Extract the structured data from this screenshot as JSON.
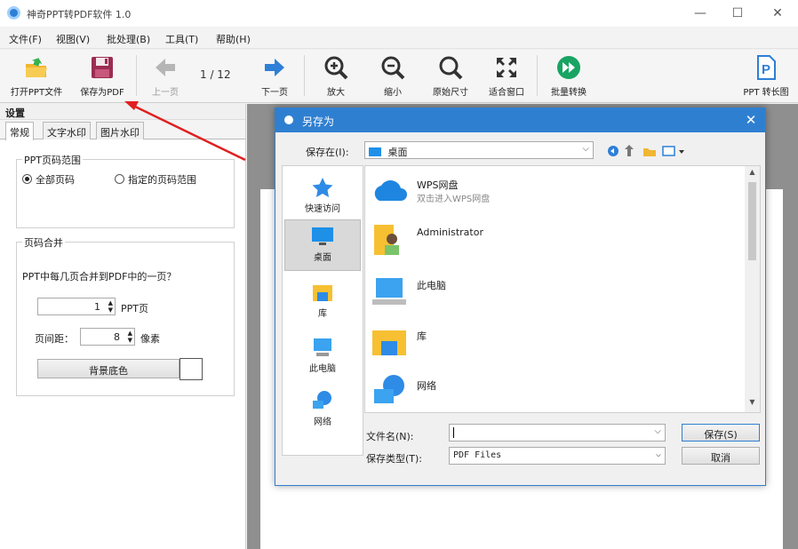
{
  "app": {
    "title": "神奇PPT转PDF软件 1.0",
    "window_controls": [
      "—",
      "☐",
      "✕"
    ]
  },
  "menu": [
    "文件(F)",
    "视图(V)",
    "批处理(B)",
    "工具(T)",
    "帮助(H)"
  ],
  "toolbar": {
    "open": "打开PPT文件",
    "save_pdf": "保存为PDF",
    "prev": "上一页",
    "page_indicator": "1 / 12",
    "next": "下一页",
    "zoom_in": "放大",
    "zoom_out": "缩小",
    "original": "原始尺寸",
    "fit": "适合窗口",
    "batch": "批量转换",
    "long_image": "PPT 转长图"
  },
  "left_panel": {
    "title": "设置",
    "tabs": [
      "常规",
      "文字水印",
      "图片水印"
    ],
    "range_group": {
      "title": "PPT页码范围",
      "all": "全部页码",
      "custom": "指定的页码范围"
    },
    "merge_group": {
      "title": "页码合并",
      "question": "PPT中每几页合并到PDF中的一页？",
      "pages_value": "1",
      "pages_unit": "PPT页",
      "spacing_label": "页间距：",
      "spacing_value": "8",
      "spacing_unit": "像素",
      "bg_button": "背景底色"
    }
  },
  "dialog": {
    "title": "另存为",
    "save_in_label": "保存在(I):",
    "save_in_value": "桌面",
    "places": [
      "快速访问",
      "桌面",
      "库",
      "此电脑",
      "网络"
    ],
    "files": [
      {
        "name": "WPS网盘",
        "sub": "双击进入WPS网盘"
      },
      {
        "name": "Administrator",
        "sub": ""
      },
      {
        "name": "此电脑",
        "sub": ""
      },
      {
        "name": "库",
        "sub": ""
      },
      {
        "name": "网络",
        "sub": ""
      }
    ],
    "filename_label": "文件名(N):",
    "filename_value": "",
    "filetype_label": "保存类型(T):",
    "filetype_value": "PDF Files",
    "save_button": "保存(S)",
    "cancel_button": "取消"
  },
  "colors": {
    "dialog_title": "#2f7fd1",
    "accent_arrow": "#e02020",
    "batch_green": "#19a463"
  }
}
